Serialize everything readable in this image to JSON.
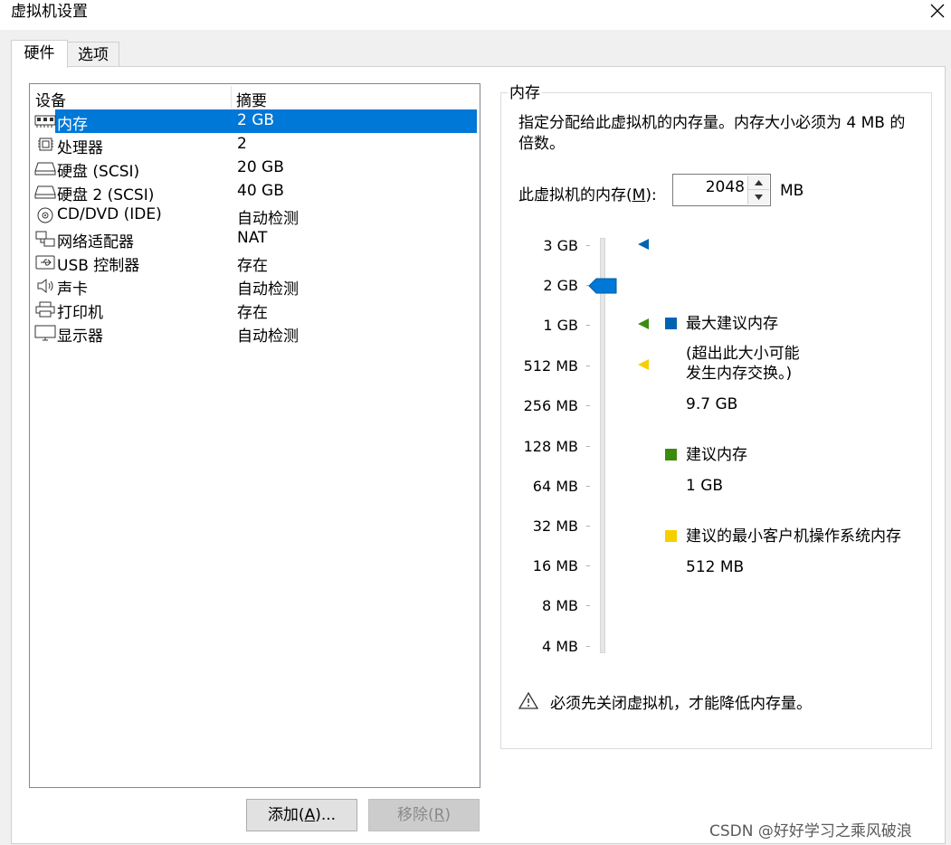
{
  "window": {
    "title": "虚拟机设置"
  },
  "tabs": [
    {
      "label": "硬件",
      "active": true
    },
    {
      "label": "选项",
      "active": false
    }
  ],
  "device_list": {
    "headers": {
      "device": "设备",
      "summary": "摘要"
    },
    "rows": [
      {
        "icon": "memory-icon",
        "name": "内存",
        "summary": "2 GB",
        "selected": true
      },
      {
        "icon": "processor-icon",
        "name": "处理器",
        "summary": "2"
      },
      {
        "icon": "hard-disk-icon",
        "name": "硬盘 (SCSI)",
        "summary": "20 GB"
      },
      {
        "icon": "hard-disk-icon",
        "name": "硬盘 2 (SCSI)",
        "summary": "40 GB"
      },
      {
        "icon": "cd-dvd-icon",
        "name": "CD/DVD (IDE)",
        "summary": "自动检测"
      },
      {
        "icon": "network-adapter-icon",
        "name": "网络适配器",
        "summary": "NAT"
      },
      {
        "icon": "usb-icon",
        "name": "USB 控制器",
        "summary": "存在"
      },
      {
        "icon": "speaker-icon",
        "name": "声卡",
        "summary": "自动检测"
      },
      {
        "icon": "printer-icon",
        "name": "打印机",
        "summary": "存在"
      },
      {
        "icon": "monitor-icon",
        "name": "显示器",
        "summary": "自动检测"
      }
    ]
  },
  "buttons": {
    "add": {
      "prefix": "添加(",
      "mnemonic": "A",
      "suffix": ")..."
    },
    "remove": {
      "prefix": "移除(",
      "mnemonic": "R",
      "suffix": ")"
    }
  },
  "memory": {
    "group_title": "内存",
    "description": "指定分配给此虚拟机的内存量。内存大小必须为 4 MB 的倍数。",
    "label_prefix": "此虚拟机的内存(",
    "label_mnemonic": "M",
    "label_suffix": "):",
    "value": "2048",
    "unit": "MB",
    "scale": [
      "3 GB",
      "2 GB",
      "1 GB",
      "512 MB",
      "256 MB",
      "128 MB",
      "64 MB",
      "32 MB",
      "16 MB",
      "8 MB",
      "4 MB"
    ],
    "current": "2 GB",
    "legend": {
      "max_title": "最大建议内存",
      "max_note_1": "(超出此大小可能",
      "max_note_2": "发生内存交换。)",
      "max_value": "9.7 GB",
      "rec_title": "建议内存",
      "rec_value": "1 GB",
      "min_title": "建议的最小客户机操作系统内存",
      "min_value": "512 MB"
    },
    "warning": "必须先关闭虚拟机，才能降低内存量。"
  },
  "colors": {
    "selection": "#0078d7",
    "max_marker": "#0063b1",
    "recommended_marker": "#3c8a0e",
    "minimum_marker": "#f5d000"
  },
  "watermark": "CSDN @好好学习之乘风破浪"
}
